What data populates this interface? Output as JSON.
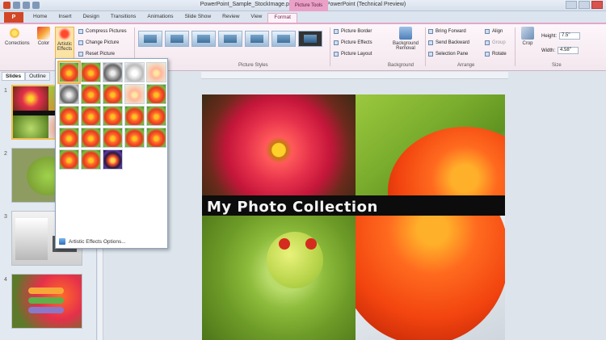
{
  "window": {
    "title": "PowerPoint_Sample_StockImage.pptx - Microsoft PowerPoint (Technical Preview)",
    "context_tab_label": "Picture Tools"
  },
  "tabs": {
    "file": "P",
    "items": [
      "Home",
      "Insert",
      "Design",
      "Transitions",
      "Animations",
      "Slide Show",
      "Review",
      "View",
      "Format"
    ],
    "active": "Format"
  },
  "ribbon": {
    "corrections": "Corrections",
    "color": "Color",
    "artistic": "Artistic Effects",
    "compress": "Compress Pictures",
    "change": "Change Picture",
    "reset": "Reset Picture",
    "picture_styles_label": "Picture Styles",
    "border": "Picture Border",
    "effects": "Picture Effects",
    "layout": "Picture Layout",
    "bg_removal": "Background Removal",
    "background_label": "Background",
    "bring_forward": "Bring Forward",
    "send_backward": "Send Backward",
    "selection_pane": "Selection Pane",
    "align": "Align",
    "group": "Group",
    "rotate": "Rotate",
    "arrange_label": "Arrange",
    "crop": "Crop",
    "height_label": "Height:",
    "height_value": "7.5\"",
    "width_label": "Width:",
    "width_value": "4.58\"",
    "size_label": "Size"
  },
  "panel": {
    "tab_slides": "Slides",
    "tab_outline": "Outline",
    "slide_numbers": [
      "1",
      "2",
      "3",
      "4"
    ]
  },
  "slide": {
    "title": "My Photo Collection"
  },
  "dropdown": {
    "footer": "Artistic Effects Options..."
  },
  "colors": {
    "accent": "#e3a8c8",
    "file_tab": "#d24726",
    "selection": "#f0b640"
  }
}
